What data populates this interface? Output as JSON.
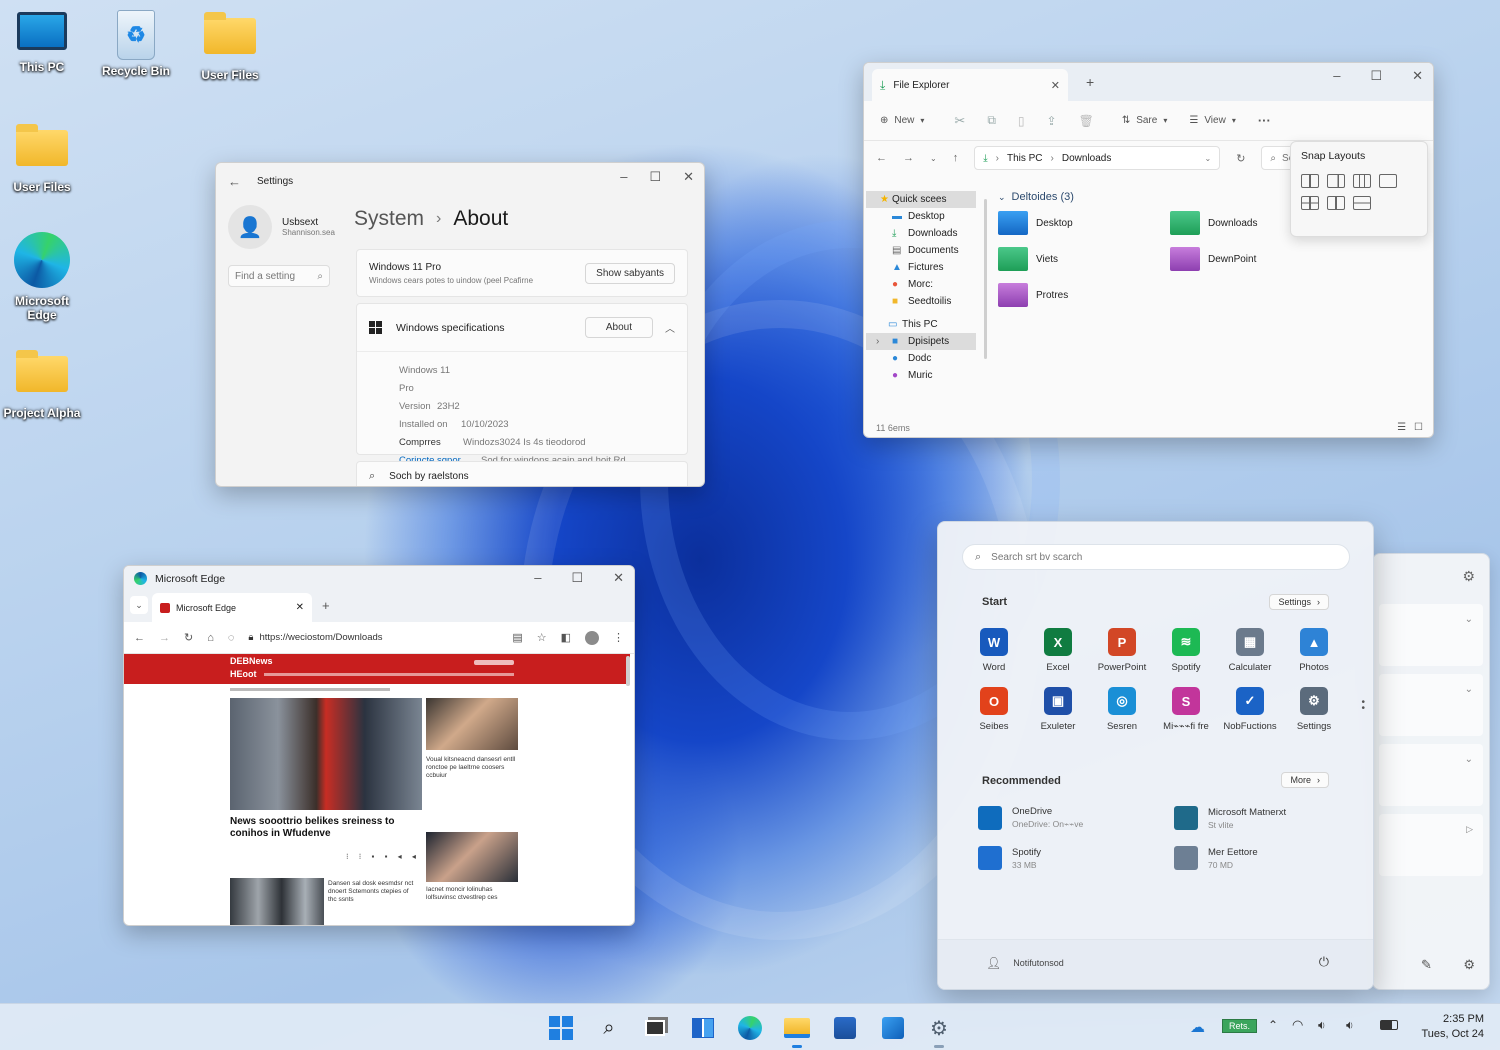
{
  "desktop": {
    "icons": [
      {
        "label": "This PC"
      },
      {
        "label": "Recycle Bin"
      },
      {
        "label": "User Files"
      },
      {
        "label": "User Files"
      },
      {
        "label": "Microsoft Edge"
      },
      {
        "label": "Project Alpha"
      }
    ]
  },
  "settings": {
    "title": "Settings",
    "user": {
      "name": "Usbsext",
      "sub": "Shannison.sea"
    },
    "search_placeholder": "Find a setting",
    "breadcrumb": {
      "parent": "System",
      "sep": "›",
      "current": "About"
    },
    "top_card": {
      "title": "Windows 11 Pro",
      "desc": "Windows cears potes to uindow (peel Pcafirne",
      "button": "Show sabyants"
    },
    "spec_card": {
      "title": "Windows specifications",
      "button": "About"
    },
    "specs": [
      {
        "label": "Windows 11 Pro",
        "value": ""
      },
      {
        "label": "Version",
        "value": "23H2"
      },
      {
        "label": "Installed on",
        "value": "10/10/2023"
      },
      {
        "label": "Comprres",
        "value": "Windozs3024 Is 4s tieodorod"
      }
    ],
    "link": {
      "label": "Corincte sgpor",
      "value": "Sod for windons acaip and hoit Rd"
    },
    "bottom_row": "Soch by raelstons"
  },
  "explorer": {
    "tab": "File Explorer",
    "toolbar": {
      "new": "New",
      "sort": "Sare",
      "view": "View",
      "more": "···"
    },
    "address": {
      "pc": "This PC",
      "folder": "Downloads"
    },
    "search_placeholder": "Sea",
    "sidebar": [
      {
        "label": "Quick scees"
      },
      {
        "label": "Desktop"
      },
      {
        "label": "Downloads"
      },
      {
        "label": "Documents"
      },
      {
        "label": "Fictures"
      },
      {
        "label": "Morc:"
      },
      {
        "label": "Seedtoilis"
      },
      {
        "label": "This PC"
      },
      {
        "label": "Dpisipets"
      },
      {
        "label": "Dodc"
      },
      {
        "label": "Muric"
      }
    ],
    "group": "Deltoides (3)",
    "files": [
      {
        "name": "Desktop"
      },
      {
        "name": "Downloads"
      },
      {
        "name": "Viets"
      },
      {
        "name": "DewnPoint"
      },
      {
        "name": "Protres"
      }
    ],
    "status": "11 6ems",
    "snap": {
      "title": "Snap Layouts"
    }
  },
  "edge": {
    "title": "Microsoft Edge",
    "tab": "Microsoft Edge",
    "url": "https://weciostom/Downloads",
    "news": {
      "brand": "DEBNews",
      "section": "HEoot",
      "headline": "News sooottrio belikes sreiness to conihos in Wfudenve",
      "side1": "Voual kitsneacnd dansesrl entll ronctoe pe laeltrne coosers ccbuiur",
      "side2": "Iacnet moncir lolinuhas lolfsuvinsc ctvestlrep ces",
      "bottom": "Dansen sal dosk eesmdsr nct dnoert Sctemonts ctepies of thc ssnts"
    }
  },
  "start": {
    "search_placeholder": "Search srt bv scarch",
    "pinned_title": "Start",
    "settings_btn": "Settings",
    "apps": [
      {
        "name": "Word",
        "color": "#185abd",
        "glyph": "W"
      },
      {
        "name": "Excel",
        "color": "#107c41",
        "glyph": "X"
      },
      {
        "name": "PowerPoint",
        "color": "#d24726",
        "glyph": "P"
      },
      {
        "name": "Spotify",
        "color": "#1db954",
        "glyph": "≋"
      },
      {
        "name": "Calculater",
        "color": "#6b7a8c",
        "glyph": "▦"
      },
      {
        "name": "Photos",
        "color": "#2e83d6",
        "glyph": "▲"
      },
      {
        "name": "Seibes",
        "color": "#e2421b",
        "glyph": "O"
      },
      {
        "name": "Exuleter",
        "color": "#1f4fa8",
        "glyph": "▣"
      },
      {
        "name": "Sesren",
        "color": "#1a8fd6",
        "glyph": "◎"
      },
      {
        "name": "Mi⌁⌁⌁fi fre",
        "color": "#c2359b",
        "glyph": "S"
      },
      {
        "name": "NobFuctions",
        "color": "#1b63c6",
        "glyph": "✓"
      },
      {
        "name": "Settings",
        "color": "#5b6b7c",
        "glyph": "⚙"
      }
    ],
    "rec_title": "Recommended",
    "more_btn": "More",
    "recommended": [
      {
        "name": "OneDrive",
        "sub": "OneDrive: On⌁⌁ve",
        "color": "#0f6cbd"
      },
      {
        "name": "Microsoft Matnerxt",
        "sub": "St vlite",
        "color": "#1f6a8a"
      },
      {
        "name": "Spotify",
        "sub": "33 MB",
        "color": "#1f6fd0"
      },
      {
        "name": "Mer Eettore",
        "sub": "70 MD",
        "color": "#6d7f94"
      }
    ],
    "user": "Notifutonsod"
  },
  "taskbar": {
    "time": "2:35 PM",
    "date": "Tues, Oct 24",
    "badge": "Rets."
  }
}
